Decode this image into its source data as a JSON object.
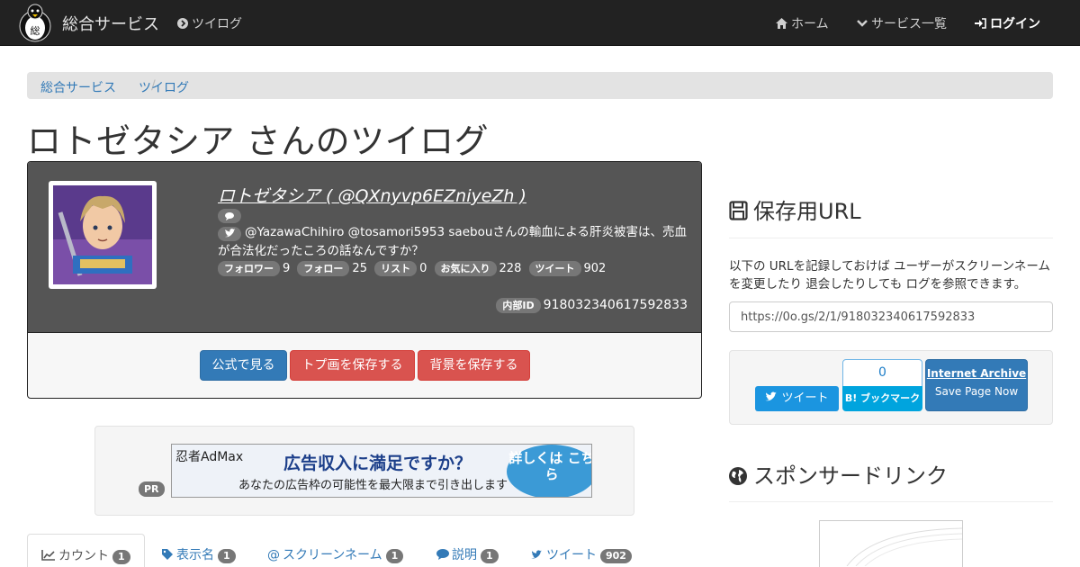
{
  "navbar": {
    "brand": "総合サービス",
    "tool": "ツイログ",
    "home": "ホーム",
    "services": "サービス一覧",
    "login": "ログイン"
  },
  "breadcrumb": [
    "総合サービス",
    "ツイログ"
  ],
  "page_title": "ロトゼタシア さんのツイログ",
  "profile": {
    "name_line": "ロトゼタシア ( @QXnyvp6EZniyeZh )",
    "bio": "@YazawaChihiro @tosamori5953 saebouさんの輸血による肝炎被害は、売血が合法化だったころの話なんですか？",
    "stats": [
      {
        "label": "フォロワー",
        "value": "9"
      },
      {
        "label": "フォロー",
        "value": "25"
      },
      {
        "label": "リスト",
        "value": "0"
      },
      {
        "label": "お気に入り",
        "value": "228"
      },
      {
        "label": "ツイート",
        "value": "902"
      }
    ],
    "internal_label": "内部ID",
    "internal_id": "918032340617592833"
  },
  "actions": {
    "official": "公式で見る",
    "save_avatar": "トプ画を保存する",
    "save_bg": "背景を保存する"
  },
  "ad": {
    "brand": "忍者AdMax",
    "headline": "広告収入に満足ですか？",
    "sub": "あなたの広告枠の可能性を最大限まで引き出します",
    "cta": "詳しくは こちら",
    "pr": "PR"
  },
  "tabs": [
    {
      "label": "カウント",
      "count": "1",
      "icon": "chart-line-icon"
    },
    {
      "label": "表示名",
      "count": "1",
      "icon": "tag-icon"
    },
    {
      "label": "スクリーンネーム",
      "count": "1",
      "icon": "at-icon"
    },
    {
      "label": "説明",
      "count": "1",
      "icon": "comment-icon"
    },
    {
      "label": "ツイート",
      "count": "902",
      "icon": "twitter-icon"
    }
  ],
  "sidebar": {
    "save_url_title": "保存用URL",
    "save_url_text": "以下の URLを記録しておけば ユーザーがスクリーンネームを変更したり 退会したりしても ログを参照できます。",
    "save_url_value": "https://0o.gs/2/1/918032340617592833",
    "tweet_button": "ツイート",
    "hatena_count": "0",
    "hatena_label": "B! ブックマーク",
    "ia_title": "Internet Archive",
    "ia_sub": "Save Page Now",
    "sponsor_title": "スポンサードリンク"
  },
  "colors": {
    "navbar": "#222222",
    "link": "#337ab7",
    "primary": "#337ab7",
    "danger": "#d9534f",
    "panel_dark": "#555555",
    "badge": "#777777"
  }
}
